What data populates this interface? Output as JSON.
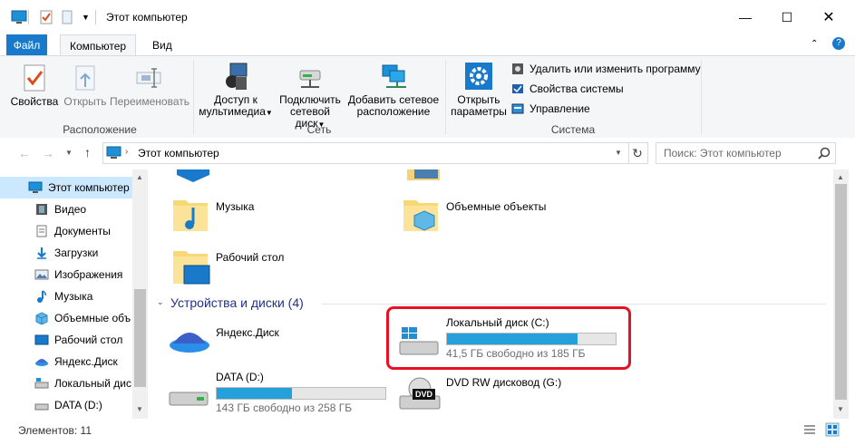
{
  "window": {
    "title": "Этот компьютер"
  },
  "ribbon_tabs": {
    "file": "Файл",
    "computer": "Компьютер",
    "view": "Вид"
  },
  "ribbon": {
    "properties": "Свойства",
    "open": "Открыть",
    "rename": "Переименовать",
    "group_location": "Расположение",
    "media_access": [
      "Доступ к",
      "мультимедиа"
    ],
    "map_drive": [
      "Подключить",
      "сетевой диск"
    ],
    "add_network": [
      "Добавить сетевое",
      "расположение"
    ],
    "group_network": "Сеть",
    "open_settings": [
      "Открыть",
      "параметры"
    ],
    "uninstall": "Удалить или изменить программу",
    "system_props": "Свойства системы",
    "manage": "Управление",
    "group_system": "Система"
  },
  "address": {
    "path": "Этот компьютер",
    "search_placeholder": "Поиск: Этот компьютер"
  },
  "sidebar": {
    "items": [
      {
        "label": "Этот компьютер",
        "icon": "computer-icon"
      },
      {
        "label": "Видео",
        "icon": "video-icon"
      },
      {
        "label": "Документы",
        "icon": "documents-icon"
      },
      {
        "label": "Загрузки",
        "icon": "downloads-icon"
      },
      {
        "label": "Изображения",
        "icon": "pictures-icon"
      },
      {
        "label": "Музыка",
        "icon": "music-icon"
      },
      {
        "label": "Объемные объ",
        "icon": "3d-objects-icon"
      },
      {
        "label": "Рабочий стол",
        "icon": "desktop-icon"
      },
      {
        "label": "Яндекс.Диск",
        "icon": "yandex-disk-icon"
      },
      {
        "label": "Локальный дис",
        "icon": "local-disk-icon"
      },
      {
        "label": "DATA (D:)",
        "icon": "drive-icon"
      }
    ]
  },
  "folders": [
    {
      "label": "Музыка"
    },
    {
      "label": "Объемные объекты"
    },
    {
      "label": "Рабочий стол"
    }
  ],
  "devices": {
    "header": "Устройства и диски (4)",
    "yandex": {
      "label": "Яндекс.Диск"
    },
    "local_c": {
      "label": "Локальный диск (C:)",
      "free": "41,5 ГБ свободно из 185 ГБ",
      "used_fraction": 0.776
    },
    "data_d": {
      "label": "DATA (D:)",
      "free": "143 ГБ свободно из 258 ГБ",
      "used_fraction": 0.446
    },
    "dvd": {
      "label": "DVD RW дисковод (G:)",
      "badge": "DVD"
    }
  },
  "status": {
    "items": "Элементов: 11"
  },
  "colors": {
    "accent": "#1979ca",
    "bar": "#26a0da",
    "highlight": "#e81123"
  }
}
